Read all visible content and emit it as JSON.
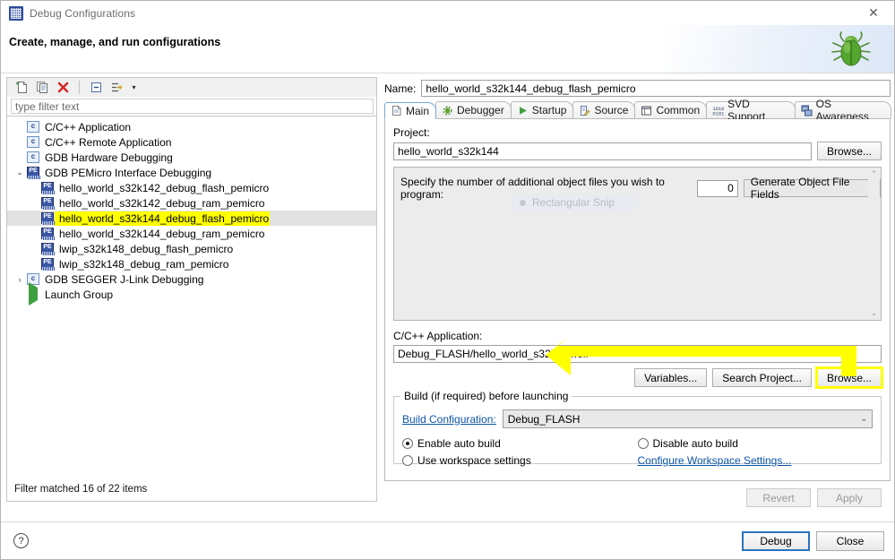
{
  "window": {
    "title": "Debug Configurations",
    "close_label": "✕",
    "banner_title": "Create, manage, and run configurations",
    "bug_icon": "green-bug-icon"
  },
  "toolbar": {
    "buttons": [
      {
        "name": "new-configuration",
        "icon": "new-page-icon"
      },
      {
        "name": "duplicate-configuration",
        "icon": "copy-icon"
      },
      {
        "name": "delete-configuration",
        "icon": "red-x-icon"
      },
      {
        "name": "collapse-all",
        "icon": "collapse-all-icon"
      },
      {
        "name": "filter-configurations",
        "icon": "filter-arrow-icon"
      }
    ],
    "dropdown_caret": "▾"
  },
  "filter": {
    "placeholder": "type filter text",
    "value": "",
    "status": "Filter matched 16 of 22 items"
  },
  "tree": {
    "items": [
      {
        "label": "C/C++ Application",
        "icon": "c-doc-icon",
        "indent": 1,
        "twist": "",
        "selected": false,
        "highlight": false
      },
      {
        "label": "C/C++ Remote Application",
        "icon": "c-doc-icon",
        "indent": 1,
        "twist": "",
        "selected": false,
        "highlight": false
      },
      {
        "label": "GDB Hardware Debugging",
        "icon": "c-doc-icon",
        "indent": 1,
        "twist": "",
        "selected": false,
        "highlight": false
      },
      {
        "label": "GDB PEMicro Interface Debugging",
        "icon": "pe-icon",
        "indent": 1,
        "twist": "⌄",
        "selected": false,
        "highlight": false
      },
      {
        "label": "hello_world_s32k142_debug_flash_pemicro",
        "icon": "pe-icon",
        "indent": 2,
        "twist": "",
        "selected": false,
        "highlight": false
      },
      {
        "label": "hello_world_s32k142_debug_ram_pemicro",
        "icon": "pe-icon",
        "indent": 2,
        "twist": "",
        "selected": false,
        "highlight": false
      },
      {
        "label": "hello_world_s32k144_debug_flash_pemicro",
        "icon": "pe-icon",
        "indent": 2,
        "twist": "",
        "selected": true,
        "highlight": true
      },
      {
        "label": "hello_world_s32k144_debug_ram_pemicro",
        "icon": "pe-icon",
        "indent": 2,
        "twist": "",
        "selected": false,
        "highlight": false
      },
      {
        "label": "lwip_s32k148_debug_flash_pemicro",
        "icon": "pe-icon",
        "indent": 2,
        "twist": "",
        "selected": false,
        "highlight": false
      },
      {
        "label": "lwip_s32k148_debug_ram_pemicro",
        "icon": "pe-icon",
        "indent": 2,
        "twist": "",
        "selected": false,
        "highlight": false
      },
      {
        "label": "GDB SEGGER J-Link Debugging",
        "icon": "c-doc-icon",
        "indent": 1,
        "twist": "›",
        "selected": false,
        "highlight": false
      },
      {
        "label": "Launch Group",
        "icon": "green-play-icon",
        "indent": 1,
        "twist": "",
        "selected": false,
        "highlight": false
      }
    ]
  },
  "config": {
    "name_label": "Name:",
    "name_value": "hello_world_s32k144_debug_flash_pemicro",
    "tabs": [
      {
        "label": "Main",
        "icon": "document-icon",
        "active": true
      },
      {
        "label": "Debugger",
        "icon": "bug-gear-icon",
        "active": false
      },
      {
        "label": "Startup",
        "icon": "green-play-icon",
        "active": false
      },
      {
        "label": "Source",
        "icon": "source-pencil-icon",
        "active": false
      },
      {
        "label": "Common",
        "icon": "window-icon",
        "active": false
      },
      {
        "label": "SVD Support",
        "icon": "binary-icon",
        "active": false
      },
      {
        "label": "OS Awareness",
        "icon": "os-icon",
        "active": false
      }
    ],
    "project_label": "Project:",
    "project_value": "hello_world_s32k144",
    "project_browse": "Browse...",
    "object_files_label": "Specify the number of additional object files you wish to program:",
    "object_files_value": "0",
    "generate_object_fields": "Generate Object File Fields",
    "scroll_up": "⌃",
    "scroll_down": "⌄",
    "app_label": "C/C++ Application:",
    "app_value": "Debug_FLASH/hello_world_s32k144.elf",
    "app_variables": "Variables...",
    "app_search_project": "Search Project...",
    "app_browse": "Browse...",
    "build_group_title": "Build (if required) before launching",
    "build_config_link": "Build Configuration:",
    "build_config_value": "Debug_FLASH",
    "build_config_caret": "⌄",
    "enable_auto_build": "Enable auto build",
    "disable_auto_build": "Disable auto build",
    "use_workspace_settings": "Use workspace settings",
    "configure_workspace_settings": "Configure Workspace Settings...",
    "build_selected": "enable",
    "revert": "Revert",
    "apply": "Apply"
  },
  "ghost_overlay": {
    "text": "Rectangular Snip"
  },
  "footer": {
    "help": "?",
    "debug": "Debug",
    "close": "Close"
  },
  "annotation": {
    "arrow_color": "#FFFF00",
    "highlight_color": "#FFFF00"
  }
}
